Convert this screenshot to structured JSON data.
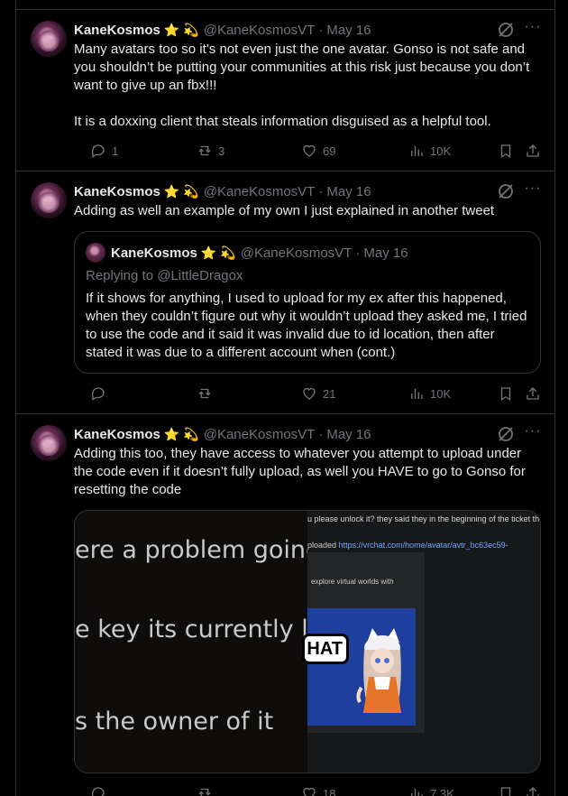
{
  "tweets": [
    {
      "name": "KaneKosmos",
      "emoji_star": "⭐",
      "emoji_swirl": "💫",
      "handle": "@KaneKosmosVT",
      "date": "May 16",
      "more": "···",
      "text": "Many avatars too so it’s not even just the one avatar. Gonso is not safe and you shouldn’t be putting your communities at this risk just because you don’t want to give up an fbx!!!\n\nIt is a doxxing client that steals information disguised as a helpful tool.",
      "replies": "1",
      "reposts": "3",
      "likes": "69",
      "views": "10K"
    },
    {
      "name": "KaneKosmos",
      "emoji_star": "⭐",
      "emoji_swirl": "💫",
      "handle": "@KaneKosmosVT",
      "date": "May 16",
      "more": "···",
      "text": "Adding as well an example of my own I just explained in another tweet",
      "quote": {
        "name": "KaneKosmos",
        "emoji_star": "⭐",
        "emoji_swirl": "💫",
        "handle": "@KaneKosmosVT",
        "date": "May 16",
        "replying": "Replying to @LittleDragox",
        "text": "If it shows for anything, I used to upload for my ex after this happened, when they couldn’t figure out why it wouldn’t upload they asked me, I tried to use the code and it said it was invalid due to id location, then after stated it was due to a different account when (cont.)"
      },
      "replies": "",
      "reposts": "",
      "likes": "21",
      "views": "10K"
    },
    {
      "name": "KaneKosmos",
      "emoji_star": "⭐",
      "emoji_swirl": "💫",
      "handle": "@KaneKosmosVT",
      "date": "May 16",
      "more": "···",
      "text": "Adding this too, they have access to whatever you attempt to upload under the code even if it doesn’t fully upload, as well you HAVE to go to Gonso for resetting the code",
      "media": {
        "line1": "ere a problem going on?",
        "line2": "e key its currently lo",
        "line3": "s the owner of it",
        "top": "u please unlock it? they said they in the beginning of the ticket tha",
        "uploaded_label": "ploaded",
        "uploaded_link": "https://vrchat.com/home/avatar/avtr_bc63ec59-",
        "explore": "explore virtual worlds with",
        "hat": "HAT"
      },
      "replies": "",
      "reposts": "",
      "likes": "18",
      "views": "7.3K"
    }
  ],
  "colors": {
    "background": "#000000",
    "text": "#e7e9ea",
    "muted": "#71767b",
    "border": "#2f3336",
    "link": "#6ea8ff"
  }
}
